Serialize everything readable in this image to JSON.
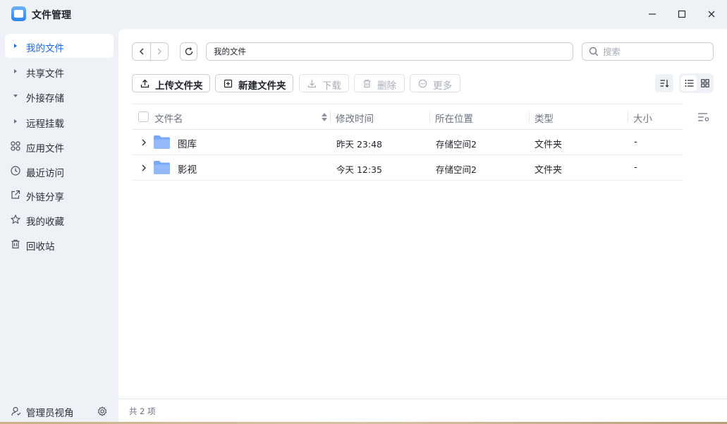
{
  "app": {
    "title": "文件管理"
  },
  "window_controls": {
    "minimize": "—",
    "maximize": "☐",
    "close": "✕"
  },
  "sidebar": {
    "items": [
      {
        "label": "我的文件",
        "kind": "caret-right",
        "active": true
      },
      {
        "label": "共享文件",
        "kind": "caret-right"
      },
      {
        "label": "外接存储",
        "kind": "caret-down"
      },
      {
        "label": "远程挂载",
        "kind": "caret-right"
      },
      {
        "label": "应用文件",
        "icon": "apps-icon"
      },
      {
        "label": "最近访问",
        "icon": "clock-icon"
      },
      {
        "label": "外链分享",
        "icon": "share-icon"
      },
      {
        "label": "我的收藏",
        "icon": "star-icon"
      },
      {
        "label": "回收站",
        "icon": "trash-icon"
      }
    ],
    "footer": {
      "label": "管理员视角",
      "icon": "admin-user-icon",
      "settings_icon": "gear-icon"
    }
  },
  "toolbar": {
    "path": "我的文件",
    "search_placeholder": "搜索",
    "buttons": {
      "upload": "上传文件夹",
      "new_folder": "新建文件夹",
      "download": "下载",
      "delete": "删除",
      "more": "更多"
    }
  },
  "table": {
    "headers": {
      "name": "文件名",
      "modified": "修改时间",
      "location": "所在位置",
      "type": "类型",
      "size": "大小"
    },
    "rows": [
      {
        "name": "图库",
        "modified": "昨天 23:48",
        "location": "存储空间2",
        "type": "文件夹",
        "size": "-"
      },
      {
        "name": "影视",
        "modified": "今天 12:35",
        "location": "存储空间2",
        "type": "文件夹",
        "size": "-"
      }
    ]
  },
  "status": {
    "count_text": "共 2 项"
  },
  "colors": {
    "accent": "#1a66e8",
    "folder": "#7aa7f5",
    "sidebar_bg": "#eef1f6"
  }
}
